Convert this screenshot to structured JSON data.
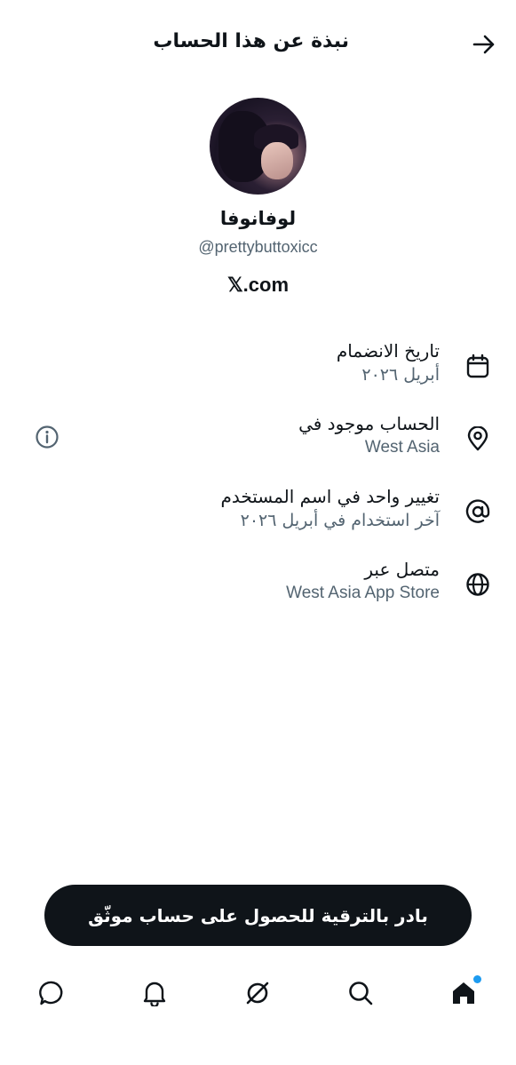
{
  "header": {
    "title": "نبذة عن هذا الحساب",
    "back_icon": "arrow-right-icon"
  },
  "profile": {
    "display_name": "لوفانوفا",
    "handle": "@prettybuttoxicc",
    "site": "𝕏.com"
  },
  "info": [
    {
      "icon": "calendar-icon",
      "title": "تاريخ الانضمام",
      "subtitle": "أبريل ٢٠٢٦"
    },
    {
      "icon": "location-pin-icon",
      "title": "الحساب موجود في",
      "subtitle": "West Asia"
    },
    {
      "icon": "at-sign-icon",
      "title": "تغيير واحد في اسم المستخدم",
      "subtitle": "آخر استخدام في أبريل ٢٠٢٦"
    },
    {
      "icon": "globe-icon",
      "title": "متصل عبر",
      "subtitle": "West Asia App Store"
    }
  ],
  "upgrade_button": {
    "label": "بادر بالترقية للحصول على حساب موثّق"
  },
  "tabbar": {
    "items": [
      "home-icon",
      "search-icon",
      "grok-icon",
      "notifications-icon",
      "messages-icon"
    ],
    "accent_color": "#1d9bf0"
  },
  "colors": {
    "primary_text": "#0f1419",
    "secondary_text": "#536471",
    "button_bg": "#0f1419"
  }
}
